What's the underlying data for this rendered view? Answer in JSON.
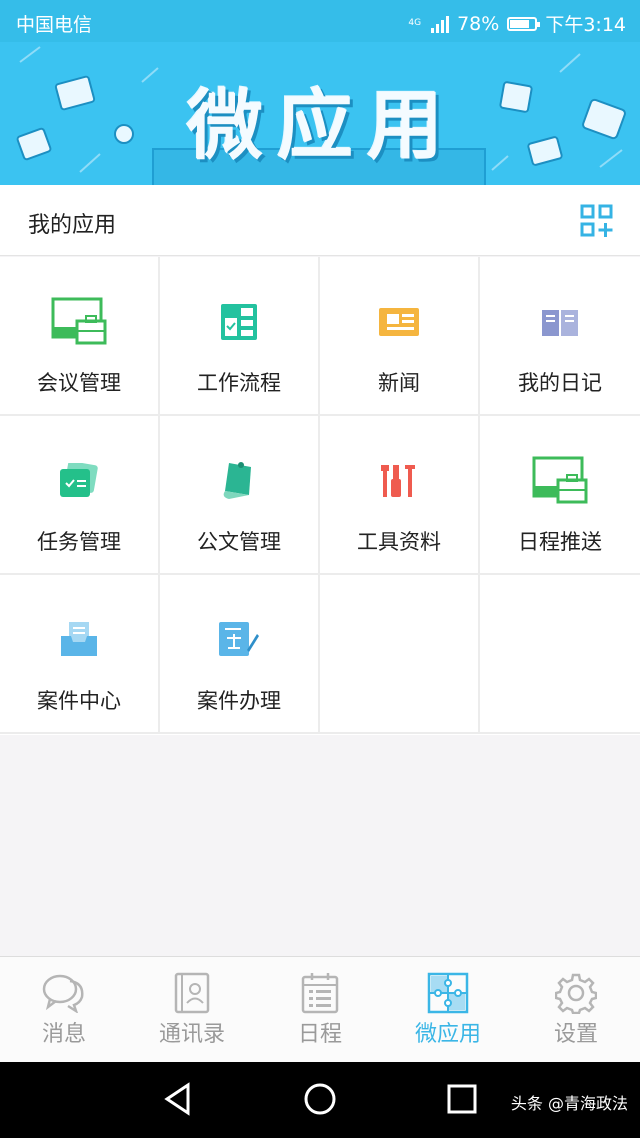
{
  "status_bar": {
    "carrier": "中国电信",
    "network": "4G",
    "battery": "78%",
    "battery_level": 0.78,
    "time": "下午3:14"
  },
  "banner": {
    "title": "微应用"
  },
  "apps_section": {
    "title": "我的应用",
    "add_icon": "qr-add-icon"
  },
  "apps": [
    {
      "label": "会议管理",
      "icon": "meeting-board-icon",
      "color": "#3dbb5a"
    },
    {
      "label": "工作流程",
      "icon": "workflow-icon",
      "color": "#23c29f"
    },
    {
      "label": "新闻",
      "icon": "newspaper-icon",
      "color": "#f5b53f"
    },
    {
      "label": "我的日记",
      "icon": "book-icon",
      "color": "#8b97cf"
    },
    {
      "label": "任务管理",
      "icon": "task-card-icon",
      "color": "#24c08a"
    },
    {
      "label": "公文管理",
      "icon": "document-scroll-icon",
      "color": "#2bb593"
    },
    {
      "label": "工具资料",
      "icon": "tools-icon",
      "color": "#ef5b4f"
    },
    {
      "label": "日程推送",
      "icon": "schedule-board-icon",
      "color": "#3dbb5a"
    },
    {
      "label": "案件中心",
      "icon": "case-inbox-icon",
      "color": "#5ab5e8"
    },
    {
      "label": "案件办理",
      "icon": "case-handle-icon",
      "color": "#5ab5e8"
    }
  ],
  "tabs": [
    {
      "label": "消息",
      "icon": "message-bubble-icon",
      "active": false
    },
    {
      "label": "通讯录",
      "icon": "contacts-icon",
      "active": false
    },
    {
      "label": "日程",
      "icon": "calendar-icon",
      "active": false
    },
    {
      "label": "微应用",
      "icon": "puzzle-icon",
      "active": true
    },
    {
      "label": "设置",
      "icon": "gear-icon",
      "active": false
    }
  ],
  "colors": {
    "accent": "#3bb6e6",
    "banner": "#3bc3f1",
    "inactive": "#9a9a9a"
  },
  "watermark": "头条 @青海政法"
}
